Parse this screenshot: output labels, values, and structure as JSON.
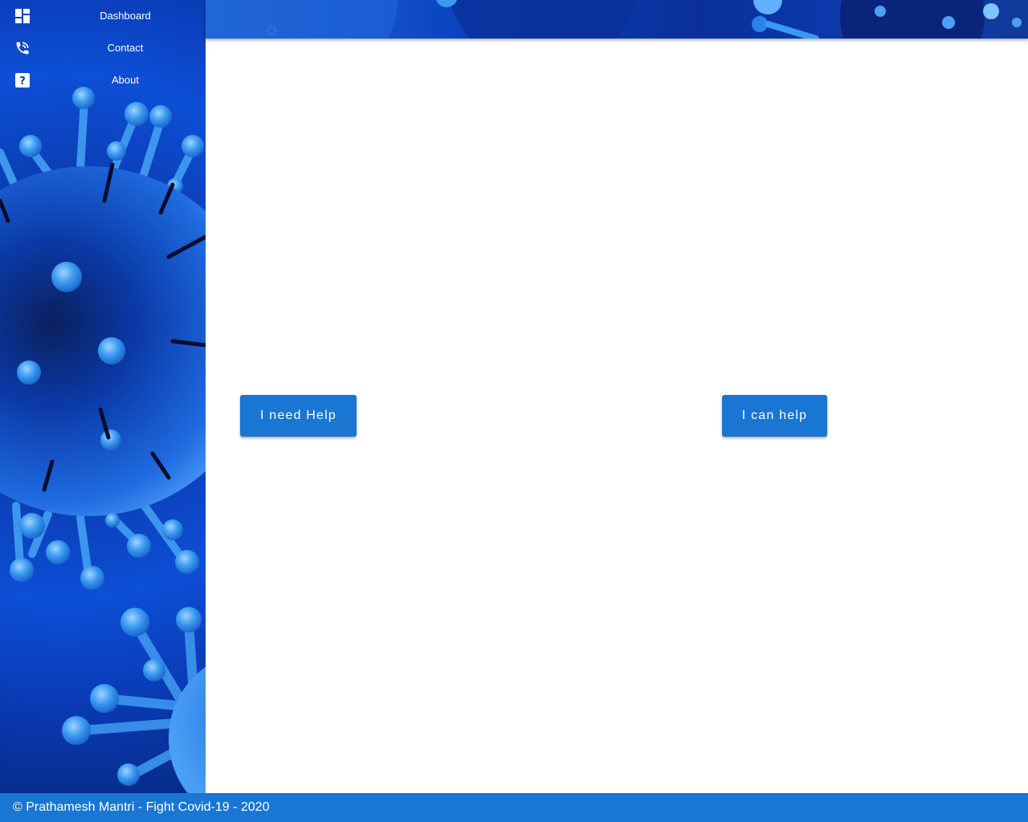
{
  "sidebar": {
    "items": [
      {
        "label": "Dashboard",
        "icon": "dashboard-icon"
      },
      {
        "label": "Contact",
        "icon": "phone-icon"
      },
      {
        "label": "About",
        "icon": "help-icon"
      }
    ]
  },
  "main": {
    "need_help_label": "I need Help",
    "can_help_label": "I can help"
  },
  "footer": {
    "text": "© Prathamesh Mantri - Fight Covid-19 - 2020"
  },
  "colors": {
    "primary": "#1976d2",
    "sidebar_blue": "#0d4fd6"
  }
}
